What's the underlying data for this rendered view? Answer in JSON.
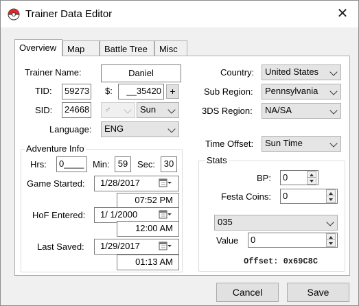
{
  "window": {
    "title": "Trainer Data Editor",
    "close_glyph": "✕",
    "app_icon": "pokeball-icon"
  },
  "tabs": [
    "Overview",
    "Map",
    "Battle Tree",
    "Misc"
  ],
  "overview": {
    "trainer_name_label": "Trainer Name:",
    "trainer_name": "Daniel",
    "tid_label": "TID:",
    "tid": "59273",
    "money_label": "$:",
    "money": "__35420",
    "money_plus": "+",
    "sid_label": "SID:",
    "sid": "24668",
    "gender": "♂",
    "game": "Sun",
    "language_label": "Language:",
    "language": "ENG",
    "country_label": "Country:",
    "country": "United States",
    "subregion_label": "Sub Region:",
    "subregion": "Pennsylvania",
    "ds_region_label": "3DS Region:",
    "ds_region": "NA/SA",
    "time_offset_label": "Time Offset:",
    "time_offset": "Sun Time"
  },
  "adventure": {
    "group_label": "Adventure Info",
    "hrs_label": "Hrs:",
    "hrs": "0____",
    "min_label": "Min:",
    "min": "59",
    "sec_label": "Sec:",
    "sec": "30",
    "game_started_label": "Game Started:",
    "game_started_date": "1/28/2017",
    "game_started_time": "07:52 PM",
    "hof_label": "HoF Entered:",
    "hof_date": "1/  1/2000",
    "hof_time": "12:00 AM",
    "last_saved_label": "Last Saved:",
    "last_saved_date": "1/29/2017",
    "last_saved_time": "01:13 AM"
  },
  "stats": {
    "group_label": "Stats",
    "bp_label": "BP:",
    "bp": "0",
    "festa_label": "Festa Coins:",
    "festa": "0",
    "selector": "035",
    "value_label": "Value",
    "value": "0",
    "offset": "Offset: 0x69C8C"
  },
  "buttons": {
    "cancel": "Cancel",
    "save": "Save"
  }
}
